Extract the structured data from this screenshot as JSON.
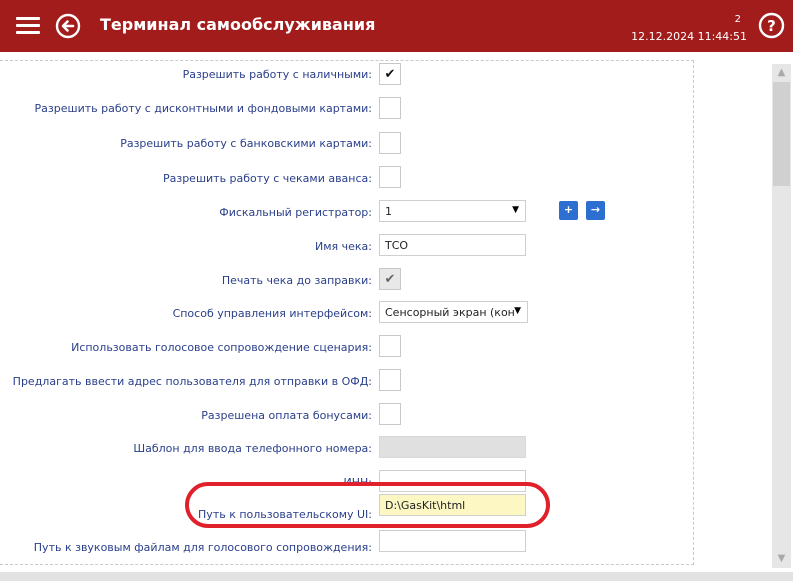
{
  "header": {
    "title": "Терминал самообслуживания",
    "counter": "2",
    "datetime": "12.12.2024 11:44:51",
    "icons": {
      "menu": "hamburger-menu-icon",
      "back": "back-arrow-circle-icon",
      "help": "help-circle-icon"
    }
  },
  "colors": {
    "titlebar": "#a31c1c",
    "label": "#2a3f8a",
    "accent_button": "#2d6fd1",
    "highlight_ring": "#e0202a",
    "yellow_field": "#fdf7c4"
  },
  "settings": {
    "cash": {
      "label": "Разрешить работу с наличными:",
      "checked": true
    },
    "discount_cards": {
      "label": "Разрешить работу с дисконтными и фондовыми картами:",
      "checked": false
    },
    "bank_cards": {
      "label": "Разрешить работу с банковскими картами:",
      "checked": false
    },
    "advance_checks": {
      "label": "Разрешить работу с чеками аванса:",
      "checked": false
    },
    "fiscal_registrar": {
      "label": "Фискальный регистратор:",
      "value": "1",
      "add_label": "+",
      "go_label": "→"
    },
    "check_name": {
      "label": "Имя чека:",
      "value": "ТСО"
    },
    "print_before_fill": {
      "label": "Печать чека до заправки:",
      "checked": true,
      "disabled": true
    },
    "ui_control": {
      "label": "Способ управления интерфейсом:",
      "value": "Сенсорный экран (кон"
    },
    "voice_guidance": {
      "label": "Использовать голосовое сопровождение сценария:",
      "checked": false
    },
    "ofd_email": {
      "label": "Предлагать ввести адрес пользователя для отправки в ОФД:",
      "checked": false
    },
    "bonus_payment": {
      "label": "Разрешена оплата бонусами:",
      "checked": false
    },
    "phone_template": {
      "label": "Шаблон для ввода телефонного номера:",
      "value": ""
    },
    "inn": {
      "label": "ИНН:",
      "value": ""
    },
    "user_ui_path": {
      "label": "Путь к пользовательскому UI:",
      "value": "D:\\GasKit\\html"
    },
    "sound_path": {
      "label": "Путь к звуковым файлам для голосового сопровождения:",
      "value": ""
    }
  },
  "scrollbar": {
    "up_label": "▲",
    "down_label": "▼"
  }
}
